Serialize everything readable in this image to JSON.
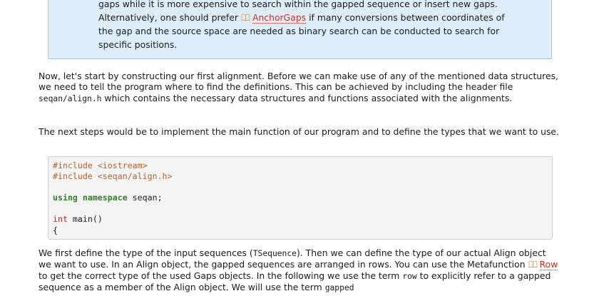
{
  "note": {
    "line1": "gaps while it is more expensive to search within the gapped sequence or insert new gaps.",
    "line2_pre": "Alternatively, one should prefer ",
    "line2_link": "AnchorGaps",
    "line2_post": " if many conversions between coordinates of",
    "line3": "the gap and the source space are needed as binary search can be conducted to search for",
    "line4": "specific positions.",
    "link_icon": "book-icon"
  },
  "para1": {
    "pre": "Now, let's start by constructing our first alignment. Before we can make use of any of the mentioned data structures, we need to tell the program where to find the definitions. This can be achieved by including the header file ",
    "code": "seqan/align.h",
    "post": " which contains the necessary data structures and functions associated with the alignments."
  },
  "para2": {
    "text": "The next steps would be to implement the main function of our program and to define the types that we want to use."
  },
  "code_block": {
    "lines": [
      {
        "kind": "pp",
        "text": "#include <iostream>"
      },
      {
        "kind": "pp",
        "text": "#include <seqan/align.h>"
      },
      {
        "kind": "blank",
        "text": ""
      },
      {
        "kind": "using",
        "kw": "using namespace",
        "rest": " seqan;"
      },
      {
        "kind": "blank",
        "text": ""
      },
      {
        "kind": "main",
        "ty": "int",
        "rest": " main()"
      },
      {
        "kind": "plain",
        "text": "{"
      }
    ]
  },
  "para3": {
    "t1": "We first define the type of the input sequences (",
    "c1": "TSequence",
    "t2": "). Then we can define the type of our actual Align object we want to use. In an Align object, the gapped sequences are arranged in rows. You can use the Metafunction ",
    "link": "Row",
    "t3": " to get the correct type of the used Gaps objects. In the following we use the term ",
    "c2": "row",
    "t4": " to explicitly refer to a gapped sequence as a member of the Align object. We will use the term ",
    "c3": "gapped"
  }
}
